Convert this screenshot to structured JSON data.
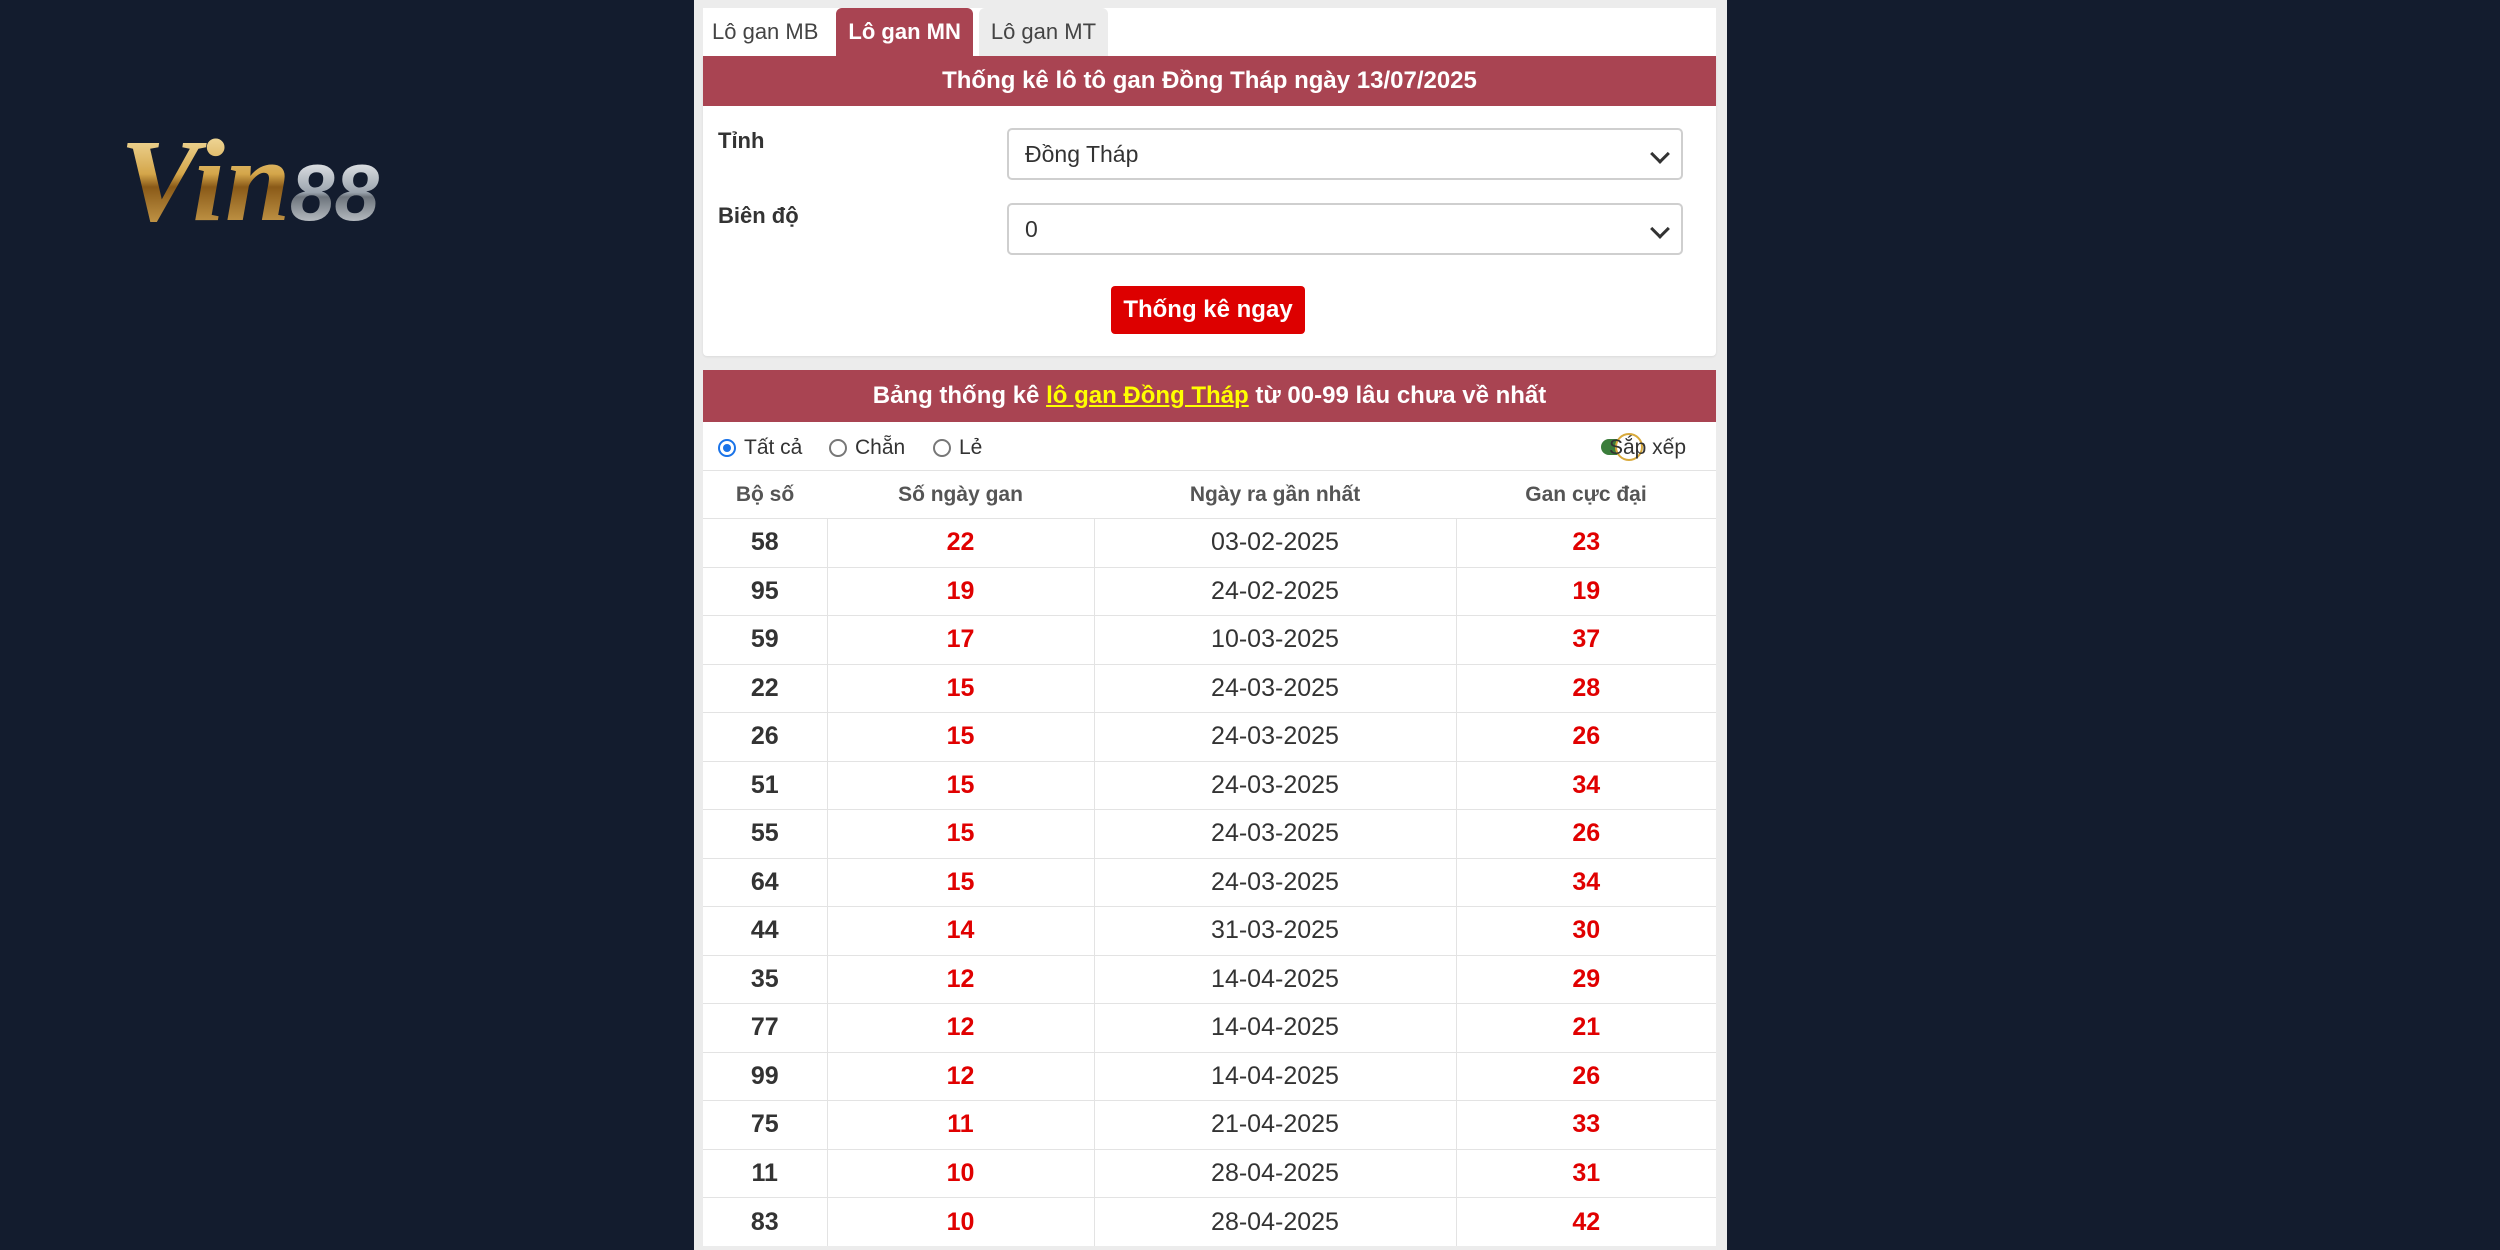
{
  "logo": {
    "text": "Vin88",
    "part1": "Vin",
    "part2": "88"
  },
  "tabs": [
    {
      "label": "Lô gan MB",
      "active": false
    },
    {
      "label": "Lô gan MN",
      "active": true
    },
    {
      "label": "Lô gan MT",
      "active": false
    }
  ],
  "form": {
    "title": "Thống kê lô tô gan Đồng Tháp ngày 13/07/2025",
    "province_label": "Tỉnh",
    "province_value": "Đồng Tháp",
    "range_label": "Biên độ",
    "range_value": "0",
    "submit_label": "Thống kê ngay"
  },
  "table_section": {
    "title_pre": "Bảng thống kê ",
    "title_link": "lô gan Đồng Tháp",
    "title_post": " từ 00-99 lâu chưa về nhất",
    "filters": {
      "all": "Tất cả",
      "even": "Chẵn",
      "odd": "Lẻ",
      "selected": "all"
    },
    "sort_label": "Sắp xếp",
    "sort_on": true,
    "columns": [
      "Bộ số",
      "Số ngày gan",
      "Ngày ra gần nhất",
      "Gan cực đại"
    ],
    "rows": [
      [
        "58",
        "22",
        "03-02-2025",
        "23"
      ],
      [
        "95",
        "19",
        "24-02-2025",
        "19"
      ],
      [
        "59",
        "17",
        "10-03-2025",
        "37"
      ],
      [
        "22",
        "15",
        "24-03-2025",
        "28"
      ],
      [
        "26",
        "15",
        "24-03-2025",
        "26"
      ],
      [
        "51",
        "15",
        "24-03-2025",
        "34"
      ],
      [
        "55",
        "15",
        "24-03-2025",
        "26"
      ],
      [
        "64",
        "15",
        "24-03-2025",
        "34"
      ],
      [
        "44",
        "14",
        "31-03-2025",
        "30"
      ],
      [
        "35",
        "12",
        "14-04-2025",
        "29"
      ],
      [
        "77",
        "12",
        "14-04-2025",
        "21"
      ],
      [
        "99",
        "12",
        "14-04-2025",
        "26"
      ],
      [
        "75",
        "11",
        "21-04-2025",
        "33"
      ],
      [
        "11",
        "10",
        "28-04-2025",
        "31"
      ],
      [
        "83",
        "10",
        "28-04-2025",
        "42"
      ]
    ]
  },
  "colors": {
    "background": "#131c2e",
    "header_bar": "#a94452",
    "accent_red": "#e00000",
    "link_yellow": "#ffff00"
  }
}
